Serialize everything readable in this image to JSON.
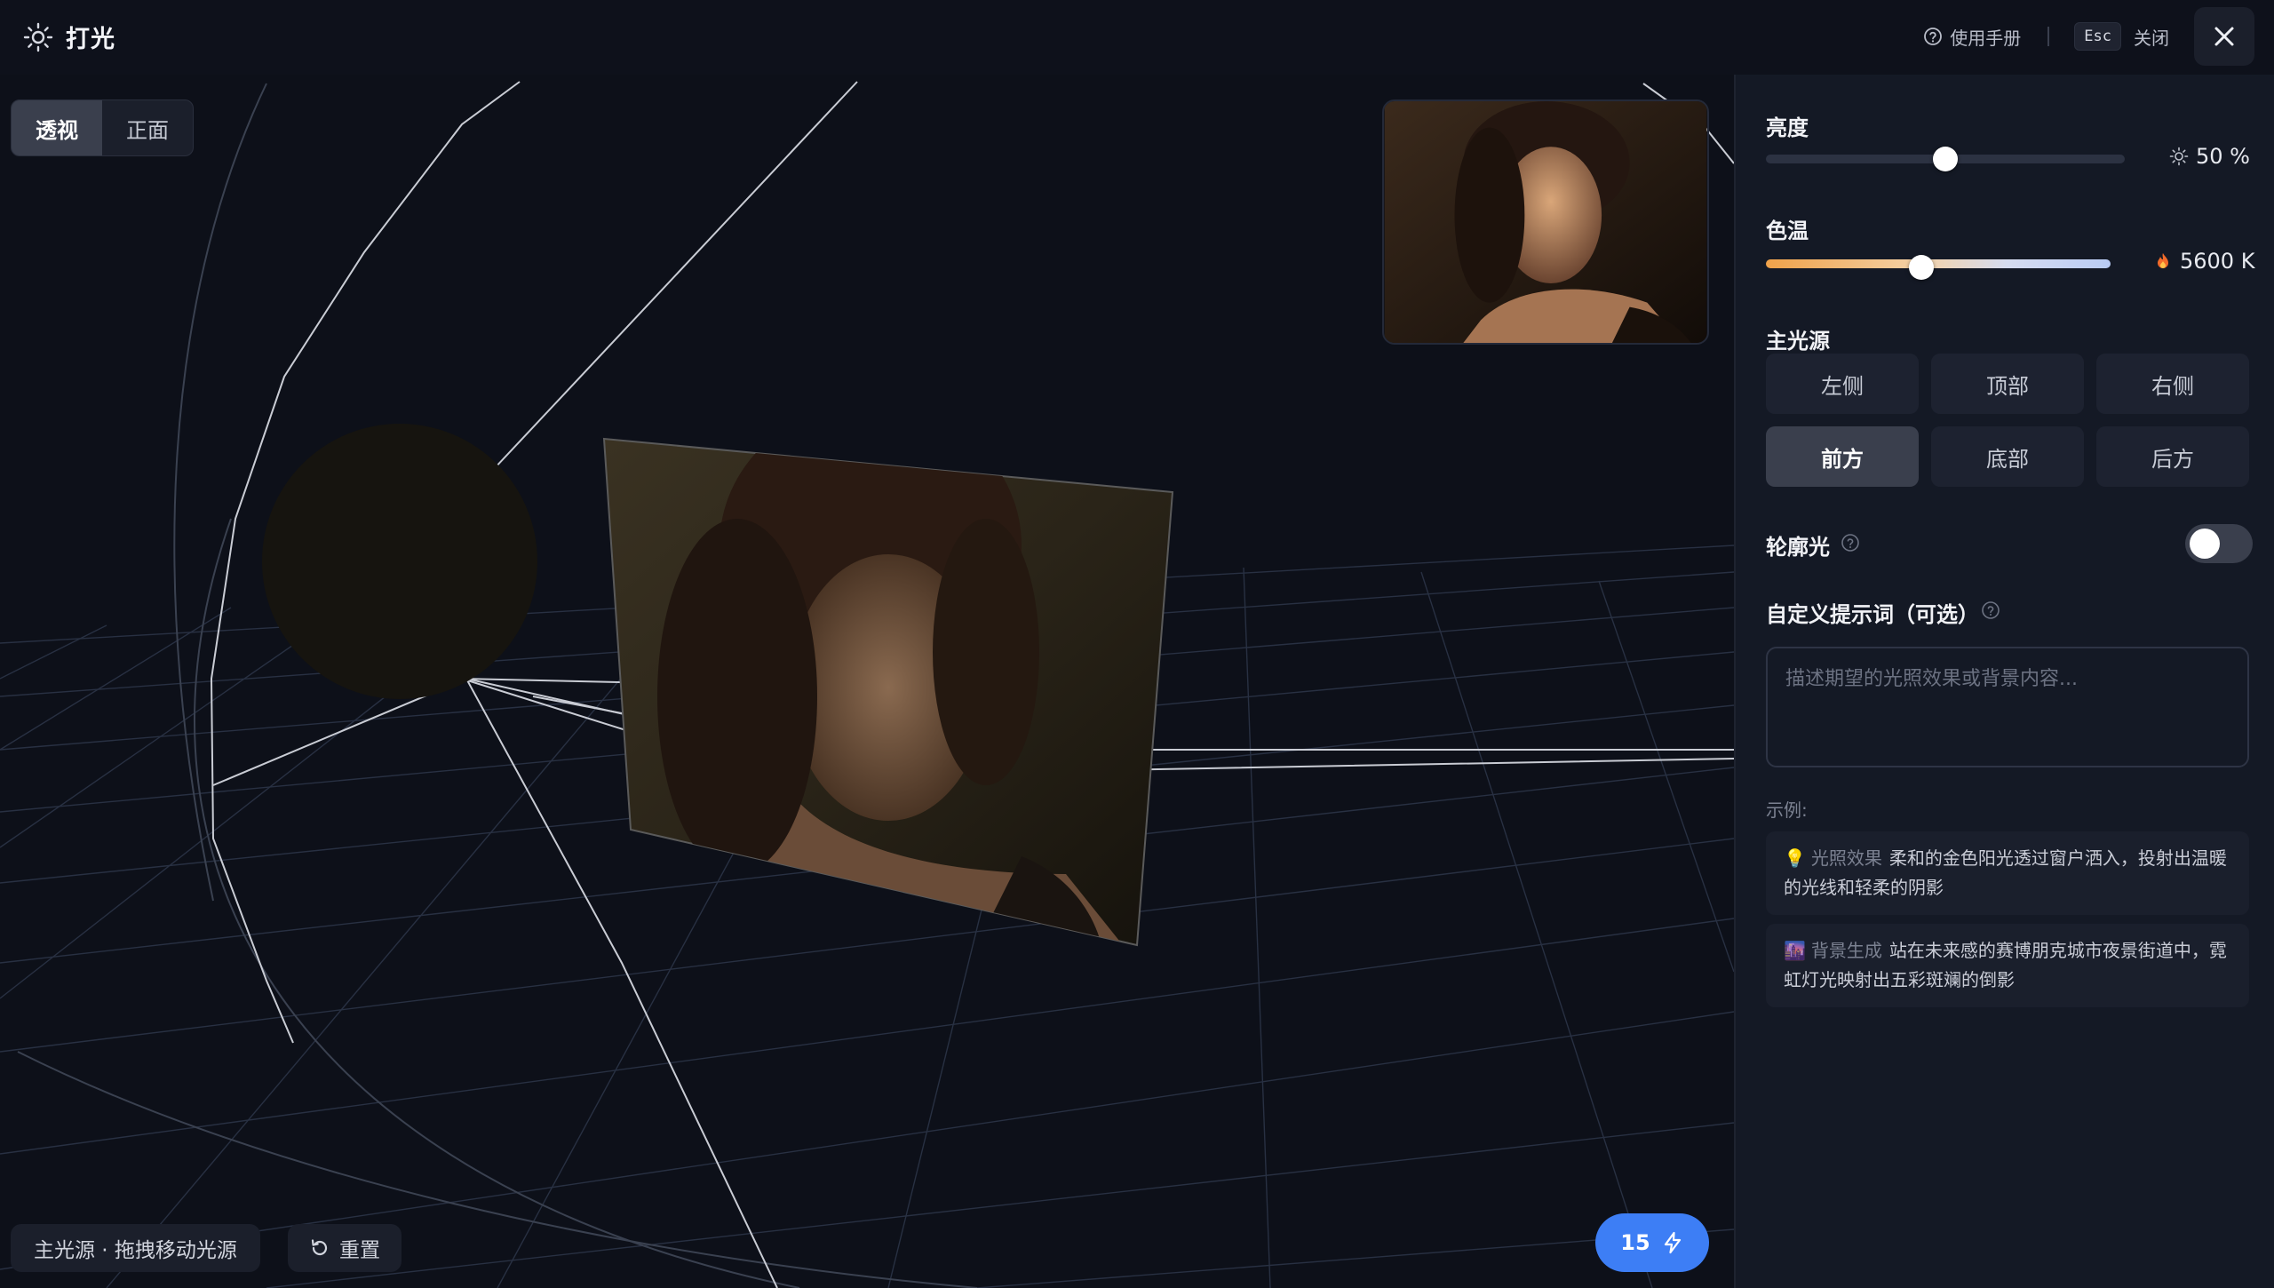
{
  "header": {
    "title": "打光",
    "manual_label": "使用手册",
    "esc_key": "Esc",
    "close_label": "关闭"
  },
  "viewport": {
    "view_tabs": [
      "透视",
      "正面"
    ],
    "active_view": "透视",
    "status_text": "主光源 · 拖拽移动光源",
    "reset_label": "重置",
    "credits": "15"
  },
  "panel": {
    "brightness": {
      "label": "亮度",
      "value": 50,
      "display": "50 %"
    },
    "color_temp": {
      "label": "色温",
      "value": 5600,
      "display": "5600 K"
    },
    "light_source": {
      "label": "主光源",
      "options": [
        "左侧",
        "顶部",
        "右侧",
        "前方",
        "底部",
        "后方"
      ],
      "selected": "前方"
    },
    "rim_light": {
      "label": "轮廓光",
      "enabled": false
    },
    "prompt": {
      "label": "自定义提示词（可选）",
      "placeholder": "描述期望的光照效果或背景内容..."
    },
    "examples": {
      "label": "示例:",
      "items": [
        {
          "emoji": "💡",
          "tag": "光照效果",
          "text": "柔和的金色阳光透过窗户洒入，投射出温暖的光线和轻柔的阴影"
        },
        {
          "emoji": "🌆",
          "tag": "背景生成",
          "text": "站在未来感的赛博朋克城市夜景街道中，霓虹灯光映射出五彩斑斓的倒影"
        }
      ]
    }
  },
  "colors": {
    "accent": "#3d7ef5",
    "panel_bg": "#141925",
    "viewport_bg": "#0d1019",
    "temp_warm": "#f0a24a",
    "temp_cool": "#b9ccf5"
  }
}
